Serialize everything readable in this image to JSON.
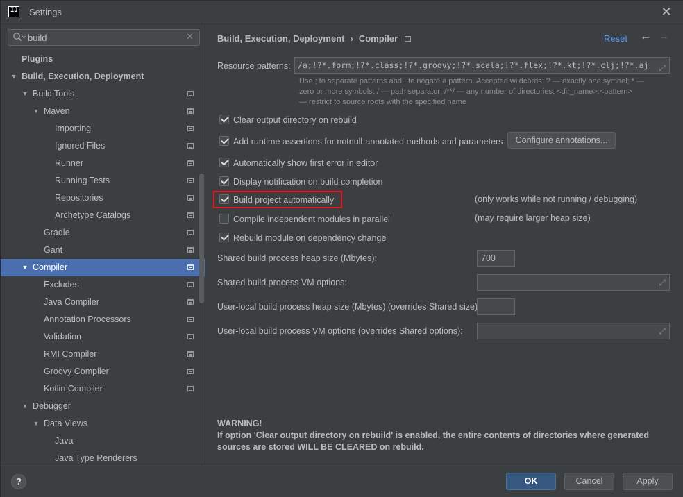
{
  "window": {
    "title": "Settings",
    "app_icon": "intellij-icon",
    "close_icon": "close-icon"
  },
  "search": {
    "value": "build",
    "placeholder": ""
  },
  "tree": [
    {
      "label": "Plugins",
      "level": 0,
      "arrow": "",
      "bold": true,
      "page_icon": false,
      "selected": false
    },
    {
      "label": "Build, Execution, Deployment",
      "level": 0,
      "arrow": "down",
      "bold": true,
      "page_icon": false,
      "selected": false
    },
    {
      "label": "Build Tools",
      "level": 1,
      "arrow": "down",
      "bold": false,
      "page_icon": true,
      "selected": false
    },
    {
      "label": "Maven",
      "level": 2,
      "arrow": "down",
      "bold": false,
      "page_icon": true,
      "selected": false
    },
    {
      "label": "Importing",
      "level": 3,
      "arrow": "",
      "bold": false,
      "page_icon": true,
      "selected": false
    },
    {
      "label": "Ignored Files",
      "level": 3,
      "arrow": "",
      "bold": false,
      "page_icon": true,
      "selected": false
    },
    {
      "label": "Runner",
      "level": 3,
      "arrow": "",
      "bold": false,
      "page_icon": true,
      "selected": false
    },
    {
      "label": "Running Tests",
      "level": 3,
      "arrow": "",
      "bold": false,
      "page_icon": true,
      "selected": false
    },
    {
      "label": "Repositories",
      "level": 3,
      "arrow": "",
      "bold": false,
      "page_icon": true,
      "selected": false
    },
    {
      "label": "Archetype Catalogs",
      "level": 3,
      "arrow": "",
      "bold": false,
      "page_icon": true,
      "selected": false
    },
    {
      "label": "Gradle",
      "level": 2,
      "arrow": "",
      "bold": false,
      "page_icon": true,
      "selected": false
    },
    {
      "label": "Gant",
      "level": 2,
      "arrow": "",
      "bold": false,
      "page_icon": true,
      "selected": false
    },
    {
      "label": "Compiler",
      "level": 1,
      "arrow": "down",
      "bold": false,
      "page_icon": true,
      "selected": true
    },
    {
      "label": "Excludes",
      "level": 2,
      "arrow": "",
      "bold": false,
      "page_icon": true,
      "selected": false
    },
    {
      "label": "Java Compiler",
      "level": 2,
      "arrow": "",
      "bold": false,
      "page_icon": true,
      "selected": false
    },
    {
      "label": "Annotation Processors",
      "level": 2,
      "arrow": "",
      "bold": false,
      "page_icon": true,
      "selected": false
    },
    {
      "label": "Validation",
      "level": 2,
      "arrow": "",
      "bold": false,
      "page_icon": true,
      "selected": false
    },
    {
      "label": "RMI Compiler",
      "level": 2,
      "arrow": "",
      "bold": false,
      "page_icon": true,
      "selected": false
    },
    {
      "label": "Groovy Compiler",
      "level": 2,
      "arrow": "",
      "bold": false,
      "page_icon": true,
      "selected": false
    },
    {
      "label": "Kotlin Compiler",
      "level": 2,
      "arrow": "",
      "bold": false,
      "page_icon": true,
      "selected": false
    },
    {
      "label": "Debugger",
      "level": 1,
      "arrow": "down",
      "bold": false,
      "page_icon": false,
      "selected": false
    },
    {
      "label": "Data Views",
      "level": 2,
      "arrow": "down",
      "bold": false,
      "page_icon": false,
      "selected": false
    },
    {
      "label": "Java",
      "level": 3,
      "arrow": "",
      "bold": false,
      "page_icon": false,
      "selected": false
    },
    {
      "label": "Java Type Renderers",
      "level": 3,
      "arrow": "",
      "bold": false,
      "page_icon": false,
      "selected": false
    }
  ],
  "breadcrumb": {
    "parent": "Build, Execution, Deployment",
    "separator": "›",
    "current": "Compiler"
  },
  "header": {
    "reset": "Reset",
    "back_icon": "arrow-left-icon",
    "forward_icon": "arrow-right-icon"
  },
  "resource_patterns": {
    "label": "Resource patterns:",
    "value": "/a;!?*.form;!?*.class;!?*.groovy;!?*.scala;!?*.flex;!?*.kt;!?*.clj;!?*.aj",
    "hint_line1": "Use ; to separate patterns and ! to negate a pattern. Accepted wildcards: ? — exactly one symbol; * —",
    "hint_line2": "zero or more symbols; / — path separator; /**/ — any number of directories; <dir_name>:<pattern>",
    "hint_line3": "— restrict to source roots with the specified name"
  },
  "options": {
    "clear_output": {
      "label": "Clear output directory on rebuild",
      "checked": true
    },
    "runtime_assertions": {
      "label": "Add runtime assertions for notnull-annotated methods and parameters",
      "checked": true
    },
    "configure_annotations": "Configure annotations...",
    "show_first_error": {
      "label": "Automatically show first error in editor",
      "checked": true
    },
    "display_notification": {
      "label": "Display notification on build completion",
      "checked": true
    },
    "build_automatically": {
      "label": "Build project automatically",
      "checked": true,
      "note": "(only works while not running / debugging)"
    },
    "compile_parallel": {
      "label": "Compile independent modules in parallel",
      "checked": false,
      "note": "(may require larger heap size)"
    },
    "rebuild_dependency": {
      "label": "Rebuild module on dependency change",
      "checked": true
    }
  },
  "fields": {
    "heap_size": {
      "label": "Shared build process heap size (Mbytes):",
      "value": "700"
    },
    "vm_options": {
      "label": "Shared build process VM options:",
      "value": ""
    },
    "user_heap": {
      "label": "User-local build process heap size (Mbytes) (overrides Shared size):",
      "value": ""
    },
    "user_vm": {
      "label": "User-local build process VM options (overrides Shared options):",
      "value": ""
    }
  },
  "warning": {
    "title": "WARNING!",
    "line1": "If option 'Clear output directory on rebuild' is enabled, the entire contents of directories where generated",
    "line2": "sources are stored WILL BE CLEARED on rebuild."
  },
  "footer": {
    "help": "?",
    "ok": "OK",
    "cancel": "Cancel",
    "apply": "Apply"
  },
  "colors": {
    "background": "#3c3f41",
    "selection": "#4b6eaf",
    "link": "#589df6",
    "primary_button": "#365880",
    "highlight_box": "#e8171f"
  }
}
